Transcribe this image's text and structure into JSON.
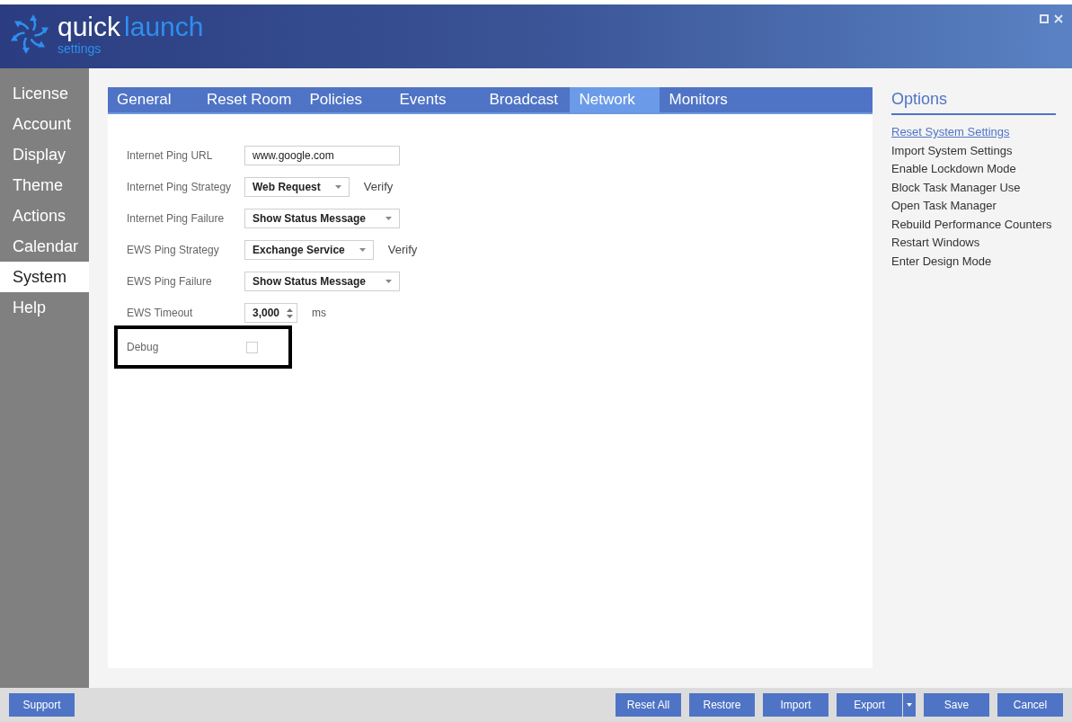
{
  "header": {
    "brand_first": "quick",
    "brand_second": "launch",
    "subtitle": "settings"
  },
  "sidebar": {
    "items": [
      {
        "label": "License",
        "selected": false
      },
      {
        "label": "Account",
        "selected": false
      },
      {
        "label": "Display",
        "selected": false
      },
      {
        "label": "Theme",
        "selected": false
      },
      {
        "label": "Actions",
        "selected": false
      },
      {
        "label": "Calendar",
        "selected": false
      },
      {
        "label": "System",
        "selected": true
      },
      {
        "label": "Help",
        "selected": false
      }
    ]
  },
  "tabs": [
    {
      "label": "General",
      "selected": false
    },
    {
      "label": "Reset Room",
      "selected": false
    },
    {
      "label": "Policies",
      "selected": false
    },
    {
      "label": "Events",
      "selected": false
    },
    {
      "label": "Broadcast",
      "selected": false
    },
    {
      "label": "Network",
      "selected": true
    },
    {
      "label": "Monitors",
      "selected": false
    }
  ],
  "form": [
    {
      "kind": "text",
      "label": "Internet Ping URL",
      "value": "www.google.com",
      "highlighted": false
    },
    {
      "kind": "select",
      "label": "Internet Ping Strategy",
      "value": "Web Request",
      "action": "Verify",
      "highlighted": false
    },
    {
      "kind": "select",
      "label": "Internet Ping Failure",
      "value": "Show Status Message",
      "highlighted": false
    },
    {
      "kind": "select",
      "label": "EWS Ping Strategy",
      "value": "Exchange Service",
      "action": "Verify",
      "highlighted": false
    },
    {
      "kind": "select",
      "label": "EWS Ping Failure",
      "value": "Show Status Message",
      "highlighted": false
    },
    {
      "kind": "number",
      "label": "EWS Timeout",
      "value": "3,000",
      "unit": "ms",
      "highlighted": false
    },
    {
      "kind": "checkbox",
      "label": "Debug",
      "checked": false,
      "highlighted": true
    }
  ],
  "options": {
    "title": "Options",
    "items": [
      {
        "label": "Reset System Settings",
        "selected": true
      },
      {
        "label": "Import System Settings",
        "selected": false
      },
      {
        "label": "Enable Lockdown Mode",
        "selected": false
      },
      {
        "label": "Block Task Manager Use",
        "selected": false
      },
      {
        "label": "Open Task Manager",
        "selected": false
      },
      {
        "label": "Rebuild Performance Counters",
        "selected": false
      },
      {
        "label": "Restart Windows",
        "selected": false
      },
      {
        "label": "Enter Design Mode",
        "selected": false
      }
    ]
  },
  "footer": {
    "left_buttons": [
      {
        "label": "Support",
        "kind": "plain"
      }
    ],
    "right_buttons": [
      {
        "label": "Reset All",
        "kind": "plain"
      },
      {
        "label": "Restore",
        "kind": "plain"
      },
      {
        "label": "Import",
        "kind": "plain"
      },
      {
        "label": "Export",
        "kind": "split"
      },
      {
        "label": "Save",
        "kind": "plain"
      },
      {
        "label": "Cancel",
        "kind": "plain"
      }
    ]
  }
}
